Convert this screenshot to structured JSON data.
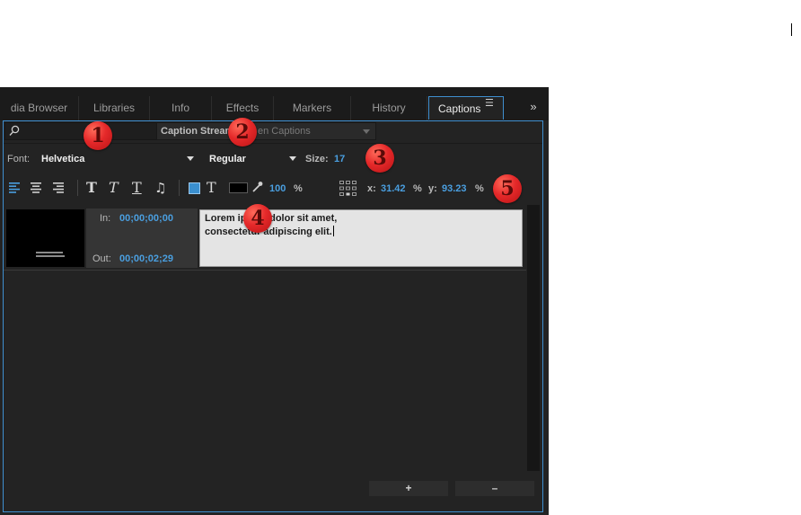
{
  "tabs": [
    {
      "label": "dia Browser"
    },
    {
      "label": "Libraries"
    },
    {
      "label": "Info"
    },
    {
      "label": "Effects"
    },
    {
      "label": "Markers"
    },
    {
      "label": "History"
    },
    {
      "label": "Captions"
    }
  ],
  "active_tab": "Captions",
  "overflow_label": "»",
  "search": {
    "value": ""
  },
  "caption_stream": {
    "label": "Caption Stream",
    "value": "en Captions"
  },
  "font": {
    "label": "Font:",
    "value": "Helvetica"
  },
  "style": {
    "value": "Regular"
  },
  "size": {
    "label": "Size:",
    "value": "17"
  },
  "opacity": {
    "value": "100",
    "unit": "%"
  },
  "position": {
    "x_label": "x:",
    "x_value": "31.42",
    "y_label": "y:",
    "y_value": "93.23",
    "unit": "%"
  },
  "caption_item": {
    "in_label": "In:",
    "in_value": "00;00;00;00",
    "out_label": "Out:",
    "out_value": "00;00;02;29",
    "text_line1": "Lorem ipsum dolor sit amet,",
    "text_line2": "consectetur adipiscing elit."
  },
  "buttons": {
    "add": "+",
    "remove": "–"
  },
  "callouts": [
    "1",
    "2",
    "3",
    "4",
    "5"
  ],
  "colors": {
    "accent": "#4a9fe0",
    "panel": "#232323",
    "badge": "#e5292a"
  }
}
